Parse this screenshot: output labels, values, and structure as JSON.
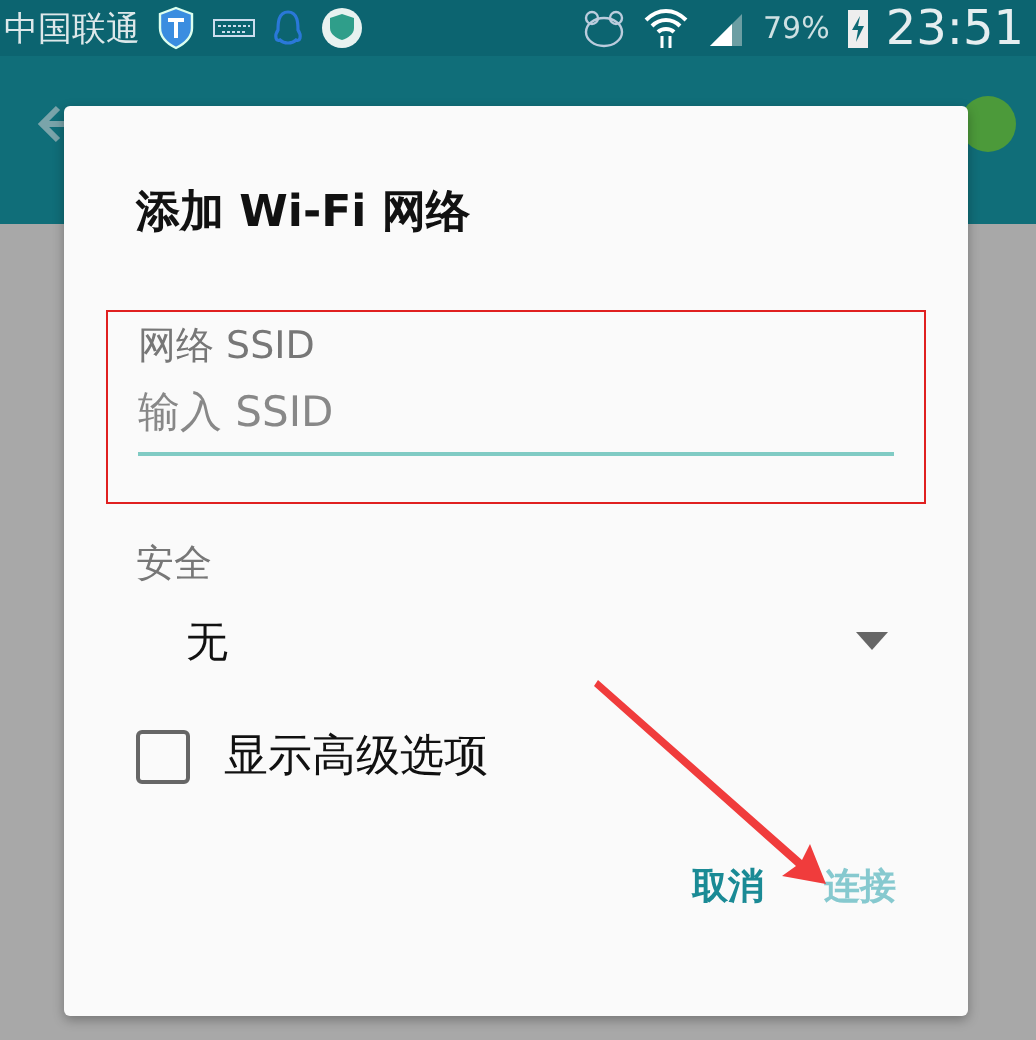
{
  "status_bar": {
    "carrier": "中国联通",
    "battery": "79%",
    "time": "23:51"
  },
  "dialog": {
    "title": "添加 Wi-Fi 网络",
    "ssid_field": {
      "label": "网络 SSID",
      "placeholder": "输入 SSID"
    },
    "security": {
      "label": "安全",
      "value": "无"
    },
    "advanced_option": {
      "label": "显示高级选项",
      "checked": false
    },
    "buttons": [
      {
        "label": "取消",
        "disabled": false
      },
      {
        "label": "连接",
        "disabled": true
      }
    ]
  },
  "annotation": {
    "highlight_box": true,
    "arrow": true
  }
}
